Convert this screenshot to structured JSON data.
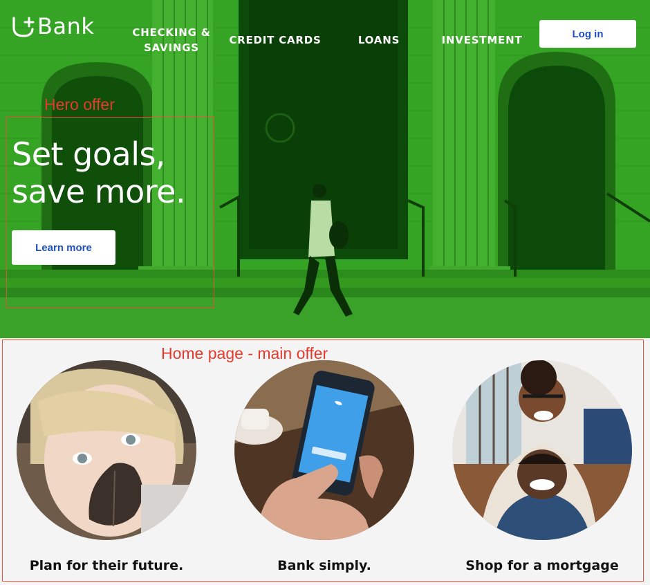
{
  "brand": {
    "name": "Bank",
    "logo_icon": "u-plus-logo-icon"
  },
  "nav": {
    "checking_line1": "CHECKING &",
    "checking_line2": "SAVINGS",
    "credit_cards": "CREDIT CARDS",
    "loans": "LOANS",
    "investment": "INVESTMENT",
    "login": "Log in"
  },
  "hero": {
    "annotation": "Hero offer",
    "heading_line1": "Set goals,",
    "heading_line2": "save more.",
    "cta": "Learn more"
  },
  "offers": {
    "annotation": "Home page - main offer",
    "items": [
      {
        "title": "Plan for their future.",
        "image": "child-with-leaf-photo"
      },
      {
        "title": "Bank simply.",
        "image": "hand-holding-phone-photo"
      },
      {
        "title": "Shop for a mortgage",
        "image": "smiling-couple-photo"
      }
    ]
  },
  "colors": {
    "hero_green": "#2f9a1f",
    "hero_dark_green": "#0c4a09",
    "button_text_blue": "#1f4fc0",
    "annotation_red": "#e53a2e",
    "offers_background": "#f4f4f4"
  }
}
